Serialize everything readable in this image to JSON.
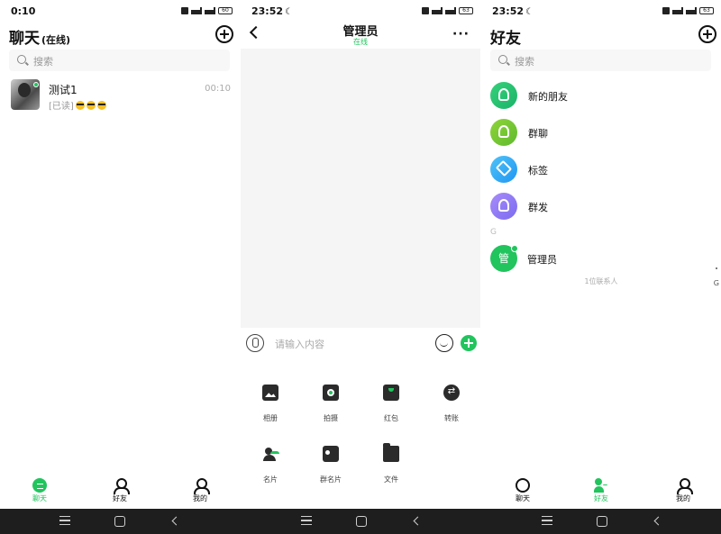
{
  "screens": {
    "chats": {
      "status_time": "0:10",
      "battery": "60",
      "title": "聊天",
      "title_status": "(在线)",
      "search_placeholder": "搜索",
      "conversations": [
        {
          "name": "测试1",
          "time": "00:10",
          "message": "[已读]"
        }
      ]
    },
    "chat_detail": {
      "status_time": "23:52",
      "battery": "63",
      "title": "管理员",
      "status": "在线",
      "more_label": "···",
      "input_placeholder": "请输入内容",
      "tools": [
        {
          "label": "相册",
          "icon": "album-icon"
        },
        {
          "label": "拍摄",
          "icon": "camera-icon"
        },
        {
          "label": "红包",
          "icon": "red-packet-icon"
        },
        {
          "label": "转账",
          "icon": "transfer-icon"
        },
        {
          "label": "名片",
          "icon": "contact-card-icon"
        },
        {
          "label": "群名片",
          "icon": "group-card-icon"
        },
        {
          "label": "文件",
          "icon": "folder-icon"
        }
      ]
    },
    "friends": {
      "status_time": "23:52",
      "battery": "63",
      "title": "好友",
      "search_placeholder": "搜索",
      "entries": [
        {
          "label": "新的朋友",
          "icon": "new-friend-icon",
          "color": "#1fc16b"
        },
        {
          "label": "群聊",
          "icon": "group-chat-icon",
          "color": "#6cc133"
        },
        {
          "label": "标签",
          "icon": "tag-icon",
          "color": "#33aaf0"
        },
        {
          "label": "群发",
          "icon": "broadcast-icon",
          "color": "#8f7cf5"
        }
      ],
      "section_letter": "G",
      "contact": {
        "avatar_char": "管",
        "name": "管理员"
      },
      "contact_count": "1位联系人",
      "index_letter": "G"
    }
  },
  "tabbar": {
    "chat_label": "聊天",
    "friends_label": "好友",
    "me_label": "我的"
  },
  "colors": {
    "accent": "#21c45d",
    "nav_bar": "#1e1e1e"
  }
}
